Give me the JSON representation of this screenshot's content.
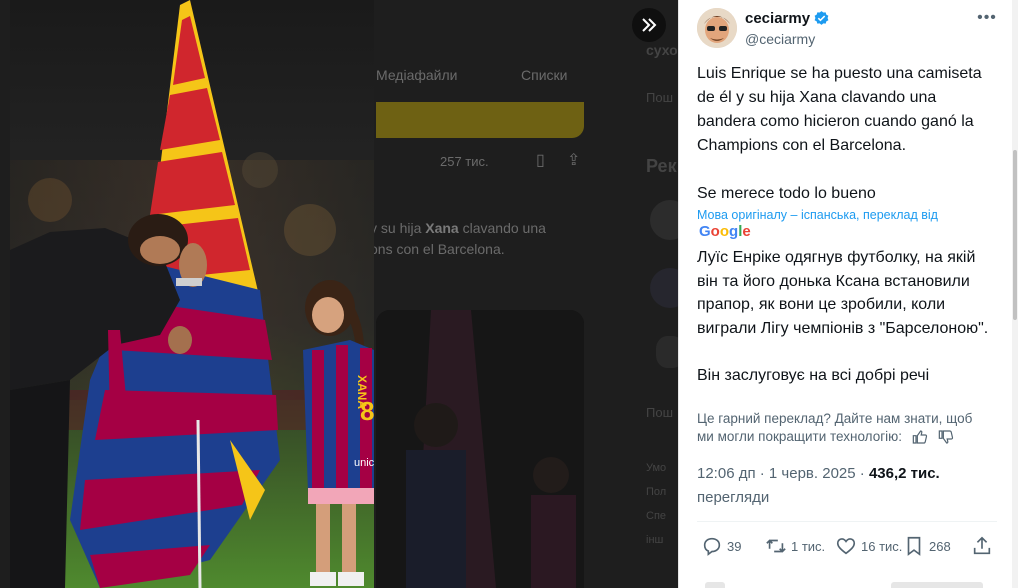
{
  "background": {
    "tabs": [
      "Медіафайли",
      "Списки"
    ],
    "stats_count": "257 тис.",
    "snippet_prefix": "y su hija",
    "snippet_name": "Xana",
    "snippet_suffix": "clavando una",
    "snippet_line2": "ons con el Barcelona.",
    "right_top": "сухо",
    "right_link": "Пош",
    "right_heading": "Рек",
    "right_link2": "Пош",
    "footer_items": [
      "Умо",
      "Пол",
      "Спе",
      "інш"
    ]
  },
  "tweet": {
    "display_name": "ceciarmy",
    "handle": "@ceciarmy",
    "text": "Luis Enrique se ha puesto una camiseta de él y su hija Xana clavando una bandera como hicieron cuando ganó la Champions con el Barcelona.\n\nSe merece todo lo bueno",
    "translation_note": "Мова оригіналу – іспанська, переклад від",
    "translator": "Google",
    "translated_text": "Луїс Енріке одягнув футболку, на якій він та його донька Ксана встановили прапор, як вони це зробили, коли виграли Лігу чемпіонів з \"Барселоною\".\n\nВін заслуговує на всі добрі речі",
    "rate_prompt": "Це гарний переклад? Дайте нам знати, щоб ми могли покращити технологію:",
    "time": "12:06 дп · 1 черв. 2025 ·",
    "views_count": "436,2 тис.",
    "views_label": "перегляди"
  },
  "actions": {
    "replies": "39",
    "reposts": "1 тис.",
    "likes": "16 тис.",
    "bookmarks": "268"
  },
  "photo": {
    "jersey_name": "XANA",
    "jersey_number": "8",
    "sponsor": "unicef"
  },
  "colors": {
    "accent": "#1d9bf0",
    "verified": "#1d9bf0",
    "barca_blue": "#1d3f8f",
    "barca_red": "#a50044",
    "senyera_yellow": "#f5c518",
    "senyera_red": "#d0262d"
  }
}
